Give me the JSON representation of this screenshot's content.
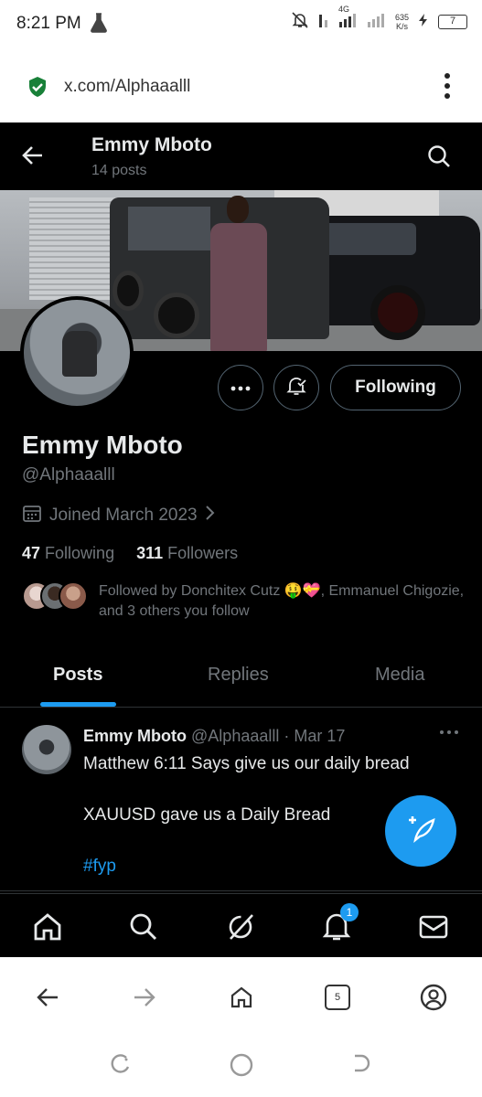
{
  "status_bar": {
    "time": "8:21 PM",
    "network": "4G",
    "speed_value": "635",
    "speed_unit": "K/s",
    "battery": "7"
  },
  "browser": {
    "url": "x.com/Alphaaalll",
    "tab_count": "5"
  },
  "header": {
    "name": "Emmy Mboto",
    "post_count": "14 posts"
  },
  "profile": {
    "name": "Emmy Mboto",
    "handle": "@Alphaaalll",
    "joined": "Joined March 2023",
    "following_count": "47",
    "following_label": "Following",
    "followers_count": "311",
    "followers_label": "Followers",
    "followed_by": "Followed by Donchitex Cutz 🤑💝, Emmanuel Chigozie, and 3 others you follow",
    "follow_button": "Following"
  },
  "tabs": [
    "Posts",
    "Replies",
    "Media"
  ],
  "post": {
    "author": "Emmy Mboto",
    "handle_date": "@Alphaaalll · Mar 17",
    "line1": "Matthew 6:11 Says give us our daily bread",
    "line2": "XAUUSD gave us a Daily Bread",
    "hashtag": "#fyp"
  },
  "notifications_badge": "1",
  "colors": {
    "accent": "#1d9bf0",
    "background": "#000000",
    "muted_text": "#71767b",
    "secure_shield": "#188038"
  },
  "icons": [
    "back-arrow-icon",
    "search-icon",
    "more-icon",
    "bell-check-icon",
    "calendar-icon",
    "chevron-right-icon",
    "home-icon",
    "grok-icon",
    "bell-icon",
    "mail-icon",
    "compose-icon"
  ]
}
